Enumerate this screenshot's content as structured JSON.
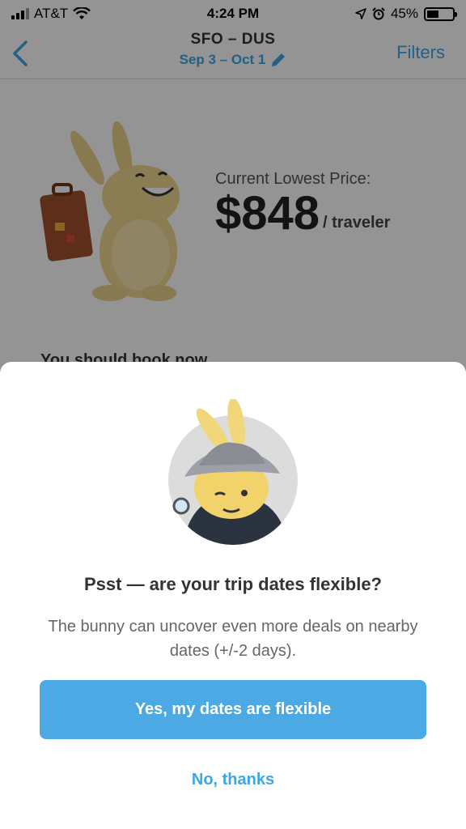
{
  "status_bar": {
    "carrier": "AT&T",
    "time": "4:24 PM",
    "battery_text": "45%",
    "battery_level": 0.45,
    "icons": [
      "signal-icon",
      "wifi-icon",
      "location-icon",
      "alarm-icon",
      "battery-icon"
    ]
  },
  "nav": {
    "route": "SFO – DUS",
    "dates": "Sep 3 – Oct 1",
    "filters_label": "Filters",
    "back_icon": "chevron-left-icon",
    "edit_icon": "pencil-icon"
  },
  "background": {
    "price_label": "Current Lowest Price:",
    "price_value": "$848",
    "price_unit": "/ traveler",
    "advice_text": "You should book now"
  },
  "modal": {
    "illustration": "detective-bunny",
    "title": "Psst — are your trip dates flexible?",
    "body": "The bunny can uncover even more deals on nearby dates (+/-2 days).",
    "primary_label": "Yes, my dates are flexible",
    "secondary_label": "No, thanks"
  },
  "colors": {
    "accent": "#3ba7e5",
    "button": "#4da9e3",
    "overlay": "rgba(0,0,0,0.42)"
  }
}
